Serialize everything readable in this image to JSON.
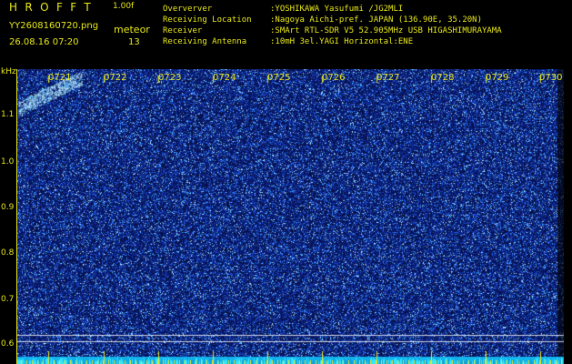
{
  "header": {
    "app_title": "HROFFT",
    "version": "1.00f",
    "filename": "YY2608160720.png",
    "datetime": "26.08.16 07:20",
    "meteor_label": "meteor",
    "meteor_count": "13"
  },
  "info": {
    "rows": [
      {
        "key": "Oververver",
        "value": ":YOSHIKAWA Yasufumi /JG2MLI"
      },
      {
        "key": "Receiving Location",
        "value": ":Nagoya Aichi-pref. JAPAN (136.90E, 35.20N)"
      },
      {
        "key": "Receiver",
        "value": ":SMArt RTL-SDR V5 52.905MHz USB HIGASHIMURAYAMA"
      },
      {
        "key": "Receiving Antenna",
        "value": ":10mH 3el.YAGI Horizontal:ENE"
      }
    ]
  },
  "axes": {
    "unit": "kHz",
    "time_labels": [
      "0721",
      "0722",
      "0723",
      "0724",
      "0725",
      "0726",
      "0727",
      "0728",
      "0729",
      "0730"
    ],
    "freq_labels": [
      "1.1",
      "1.0",
      "0.9",
      "0.8",
      "0.7",
      "0.6"
    ]
  },
  "colors": {
    "text": "#e8e81a",
    "background": "#000000",
    "noise_dark": "#0a1b8a",
    "noise_mid": "#1f4dd8",
    "noise_bright": "#5fb6ff",
    "baseline": "#18d7ff"
  }
}
